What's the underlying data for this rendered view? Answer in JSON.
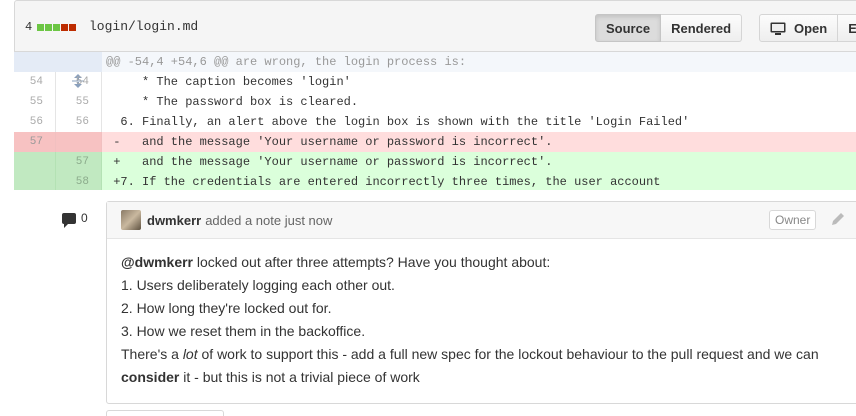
{
  "file": {
    "diffstat_count": "4",
    "diffstat_colors": [
      "#6cc644",
      "#6cc644",
      "#6cc644",
      "#bd2c00",
      "#bd2c00"
    ],
    "path": "login/login.md"
  },
  "toolbar": {
    "source_label": "Source",
    "rendered_label": "Rendered",
    "open_label": "Open",
    "edit_label": "Edi"
  },
  "diff": {
    "hunk_header": "@@ -54,4 +54,6 @@ are wrong, the login process is:",
    "rows": [
      {
        "type": "ctx",
        "old": "54",
        "new": "54",
        "text": "     * The caption becomes 'login'"
      },
      {
        "type": "ctx",
        "old": "55",
        "new": "55",
        "text": "     * The password box is cleared."
      },
      {
        "type": "ctx",
        "old": "56",
        "new": "56",
        "text": "  6. Finally, an alert above the login box is shown with the title 'Login Failed'"
      },
      {
        "type": "del",
        "old": "57",
        "new": "",
        "text": " -   and the message 'Your username or password is incorrect'."
      },
      {
        "type": "add",
        "old": "",
        "new": "57",
        "text": " +   and the message 'Your username or password is incorrect'."
      },
      {
        "type": "add",
        "old": "",
        "new": "58",
        "text": " +7. If the credentials are entered incorrectly three times, the user account"
      }
    ]
  },
  "comment_count": "0",
  "comment": {
    "author": "dwmkerr",
    "action": "added a note just now",
    "badge": "Owner",
    "mention": "@dwmkerr",
    "line1_rest": " locked out after three attempts? Have you thought about:",
    "item1": "1. Users deliberately logging each other out.",
    "item2": "2. How long they're locked out for.",
    "item3": "3. How we reset them in the backoffice.",
    "p_a": "There's a ",
    "p_em": "lot",
    "p_b": " of work to support this - add a full new spec for the lockout behaviour to the pull request and we can",
    "p_strong": "consider",
    "p_c": " it - but this is not a trivial piece of work"
  }
}
